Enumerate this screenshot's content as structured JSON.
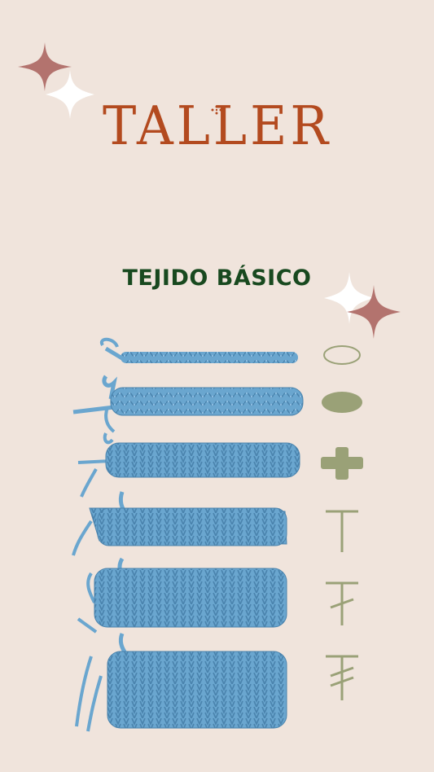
{
  "title": "TALLER",
  "subtitle": "TEJIDO BÁSICO",
  "colors": {
    "background": "#f0e4dc",
    "title": "#b34a1f",
    "subtitle": "#18491f",
    "sparkle_rose": "#b3736e",
    "sparkle_white": "#ffffff",
    "yarn": "#6aa6cf",
    "yarn_dark": "#4a83ad",
    "symbol": "#9aa177"
  },
  "stitch_symbols": [
    {
      "name": "chain",
      "icon": "oval-outline-icon"
    },
    {
      "name": "slip-stitch",
      "icon": "filled-oval-icon"
    },
    {
      "name": "single-crochet",
      "icon": "plus-icon"
    },
    {
      "name": "half-double-crochet",
      "icon": "t-icon"
    },
    {
      "name": "double-crochet",
      "icon": "t-one-bar-icon"
    },
    {
      "name": "treble-crochet",
      "icon": "t-two-bar-icon"
    }
  ]
}
